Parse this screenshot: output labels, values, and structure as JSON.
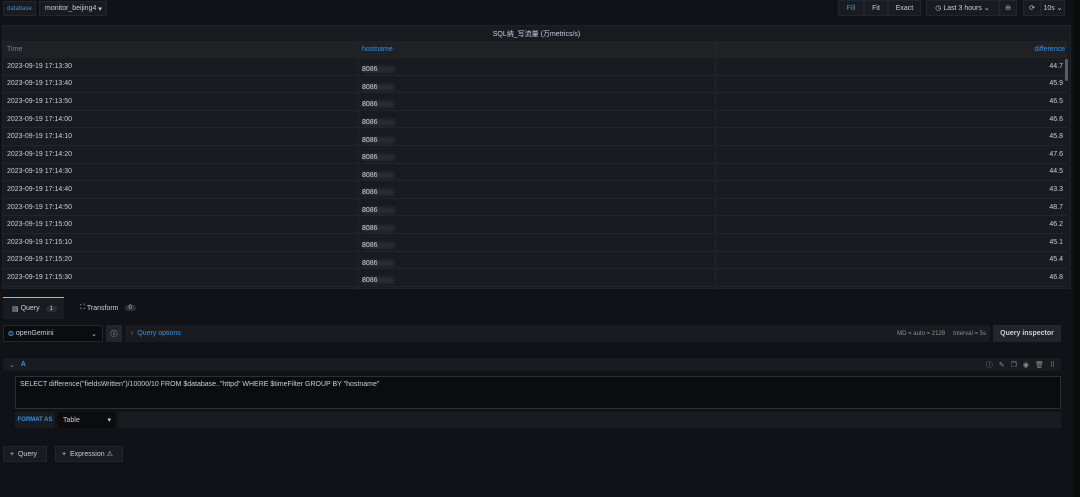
{
  "topbar": {
    "var_label": "database",
    "var_value": "monitor_beijing4",
    "fill": "Fill",
    "fit": "Fit",
    "exact": "Exact",
    "time_range": "Last 3 hours",
    "refresh": "10s"
  },
  "panel": {
    "title": "SQL纳_写流量 (万metrics/s)",
    "columns": [
      "Time",
      "hostname",
      "difference"
    ],
    "rows": [
      [
        "2023-09-19 17:13:30",
        "21.",
        "8086",
        "44.7"
      ],
      [
        "2023-09-19 17:13:40",
        "21.",
        "8086",
        "45.9"
      ],
      [
        "2023-09-19 17:13:50",
        "21.",
        "8086",
        "46.5"
      ],
      [
        "2023-09-19 17:14:00",
        "21.",
        "8086",
        "46.6"
      ],
      [
        "2023-09-19 17:14:10",
        "21.",
        "8086",
        "45.8"
      ],
      [
        "2023-09-19 17:14:20",
        "21.",
        "8086",
        "47.6"
      ],
      [
        "2023-09-19 17:14:30",
        "21.",
        "8086",
        "44.5"
      ],
      [
        "2023-09-19 17:14:40",
        "21.",
        "8086",
        "43.3"
      ],
      [
        "2023-09-19 17:14:50",
        "21.",
        "8086",
        "48.7"
      ],
      [
        "2023-09-19 17:15:00",
        "21.",
        "8086",
        "46.2"
      ],
      [
        "2023-09-19 17:15:10",
        "21.",
        "8086",
        "45.1"
      ],
      [
        "2023-09-19 17:15:20",
        "21.",
        "8086",
        "45.4"
      ],
      [
        "2023-09-19 17:15:30",
        "21.",
        "8086",
        "46.8"
      ]
    ]
  },
  "editor": {
    "tabs": [
      {
        "label": "Query",
        "count": "1"
      },
      {
        "label": "Transform",
        "count": "0"
      }
    ],
    "datasource": "openGemini",
    "query_options": "Query options",
    "meta": "MD = auto = 2128",
    "interval": "Interval = 5s",
    "inspector": "Query inspector",
    "query_ref": "A",
    "sql": "SELECT difference(\"fieldsWritten\")/10000/10 FROM $database..\"httpd\" WHERE  $timeFilter GROUP BY \"hostname\"",
    "format_label": "FORMAT AS",
    "format_value": "Table",
    "add_query": "Query",
    "add_expression": "Expression"
  }
}
